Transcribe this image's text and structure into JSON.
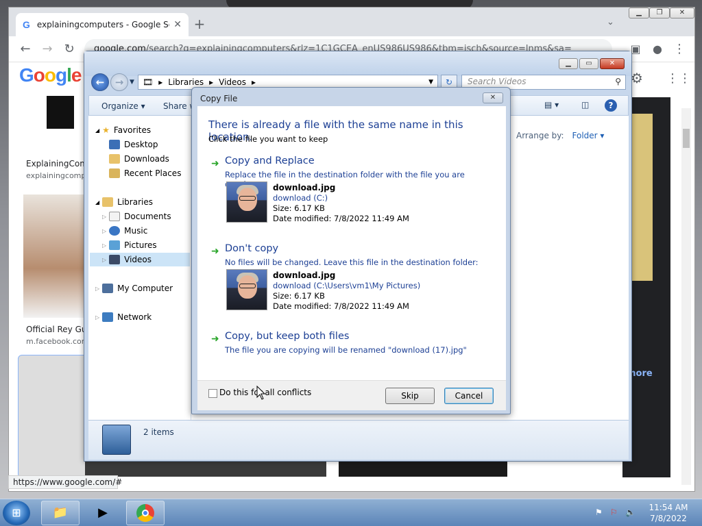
{
  "browser": {
    "tab_title": "explainingcomputers - Google Se",
    "tab_icon": "G",
    "tab_close": "✕",
    "new_tab": "+",
    "url_domain": "google.com",
    "url_rest": "/search?q=explainingcomputers&rlz=1C1GCEA_enUS986US986&tbm=isch&source=lnms&sa=",
    "google_logo": "Google",
    "results": [
      {
        "title": "ExplainingComp",
        "url": "explainingcompu"
      },
      {
        "title": "Official Rey Gur",
        "url": "m.facebook.com"
      }
    ],
    "more_link": "more",
    "status_url": "https://www.google.com/#"
  },
  "explorer": {
    "breadcrumb": [
      "Libraries",
      "Videos"
    ],
    "search_placeholder": "Search Videos",
    "toolbar": {
      "organize": "Organize ▾",
      "share": "Share w"
    },
    "nav": {
      "favorites": "Favorites",
      "desktop": "Desktop",
      "downloads": "Downloads",
      "recent_places": "Recent Places",
      "libraries": "Libraries",
      "documents": "Documents",
      "music": "Music",
      "pictures": "Pictures",
      "videos": "Videos",
      "my_computer": "My Computer",
      "network": "Network"
    },
    "arrange_label": "Arrange by:",
    "arrange_value": "Folder ▾",
    "item_count": "2 items"
  },
  "dialog": {
    "title": "Copy File",
    "heading": "There is already a file with the same name in this location.",
    "subheading": "Click the file you want to keep",
    "option_replace": {
      "title": "Copy and Replace",
      "desc": "Replace the file in the destination folder with the file you are copying:",
      "file_name": "download.jpg",
      "file_location": "download (C:)",
      "size": "Size: 6.17 KB",
      "modified": "Date modified: 7/8/2022 11:49 AM"
    },
    "option_dont_copy": {
      "title": "Don't copy",
      "desc": "No files will be changed. Leave this file in the destination folder:",
      "file_name": "download.jpg",
      "file_location": "download (C:\\Users\\vm1\\My Pictures)",
      "size": "Size: 6.17 KB",
      "modified": "Date modified: 7/8/2022 11:49 AM"
    },
    "option_keep_both": {
      "title": "Copy, but keep both files",
      "desc": "The file you are copying will be renamed \"download (17).jpg\""
    },
    "checkbox_label": "Do this for all conflicts",
    "skip_button": "Skip",
    "cancel_button": "Cancel",
    "close_glyph": "✕",
    "option_arrow": "➜"
  },
  "taskbar": {
    "time": "11:54 AM",
    "date": "7/8/2022"
  },
  "colors": {
    "dialog_link_blue": "#1c3f94",
    "option_arrow_green": "#2aa52a",
    "explorer_chrome": "#c7d7ec"
  }
}
